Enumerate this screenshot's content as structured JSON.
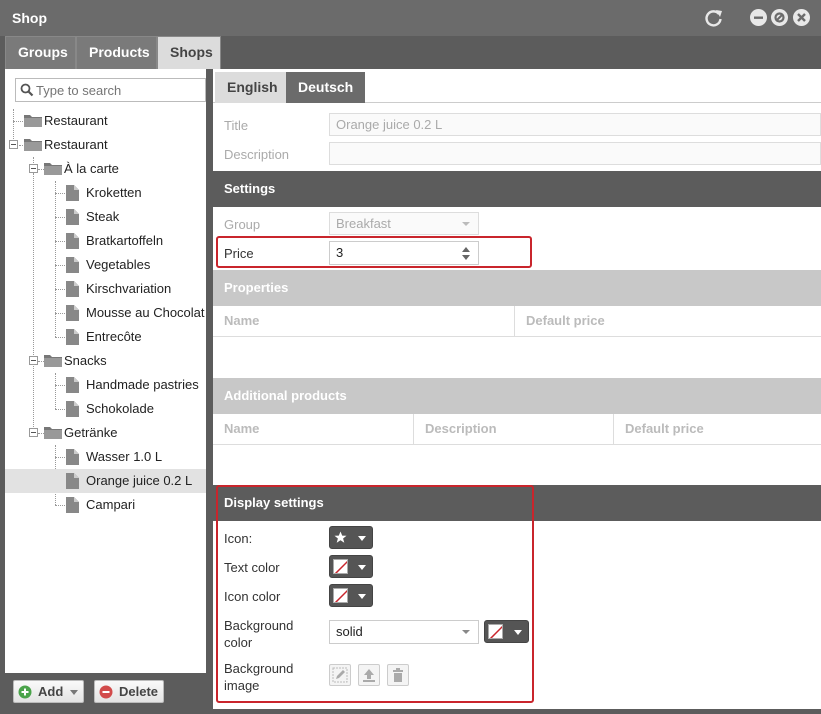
{
  "window": {
    "title": "Shop"
  },
  "top_tabs": [
    {
      "label": "Groups"
    },
    {
      "label": "Products"
    },
    {
      "label": "Shops"
    }
  ],
  "search": {
    "placeholder": "Type to search"
  },
  "tree": [
    {
      "label": "Restaurant"
    },
    {
      "label": "Restaurant"
    },
    {
      "label": "À la carte"
    },
    {
      "label": "Kroketten"
    },
    {
      "label": "Steak"
    },
    {
      "label": "Bratkartoffeln"
    },
    {
      "label": "Vegetables"
    },
    {
      "label": "Kirschvariation"
    },
    {
      "label": "Mousse au Chocolat"
    },
    {
      "label": "Entrecôte"
    },
    {
      "label": "Snacks"
    },
    {
      "label": "Handmade pastries"
    },
    {
      "label": "Schokolade"
    },
    {
      "label": "Getränke"
    },
    {
      "label": "Wasser 1.0 L"
    },
    {
      "label": "Orange juice 0.2 L"
    },
    {
      "label": "Campari"
    }
  ],
  "footer": {
    "add_label": "Add",
    "delete_label": "Delete"
  },
  "lang_tabs": [
    {
      "label": "English"
    },
    {
      "label": "Deutsch"
    }
  ],
  "form": {
    "title_label": "Title",
    "title_value": "Orange juice 0.2 L",
    "description_label": "Description",
    "description_value": ""
  },
  "settings": {
    "header": "Settings",
    "group_label": "Group",
    "group_value": "Breakfast",
    "price_label": "Price",
    "price_value": "3"
  },
  "properties": {
    "header": "Properties",
    "columns": [
      "Name",
      "Default price"
    ]
  },
  "additional_products": {
    "header": "Additional products",
    "columns": [
      "Name",
      "Description",
      "Default price"
    ]
  },
  "display_settings": {
    "header": "Display settings",
    "icon_label": "Icon:",
    "text_color_label": "Text color",
    "icon_color_label": "Icon color",
    "background_color_label_1": "Background",
    "background_color_label_2": "color",
    "background_color_value": "solid",
    "background_image_label_1": "Background",
    "background_image_label_2": "image"
  },
  "colors": {
    "highlight_red": "#c9252c",
    "dark_header": "#5c5c5c",
    "light_header": "#c8c8c8"
  }
}
